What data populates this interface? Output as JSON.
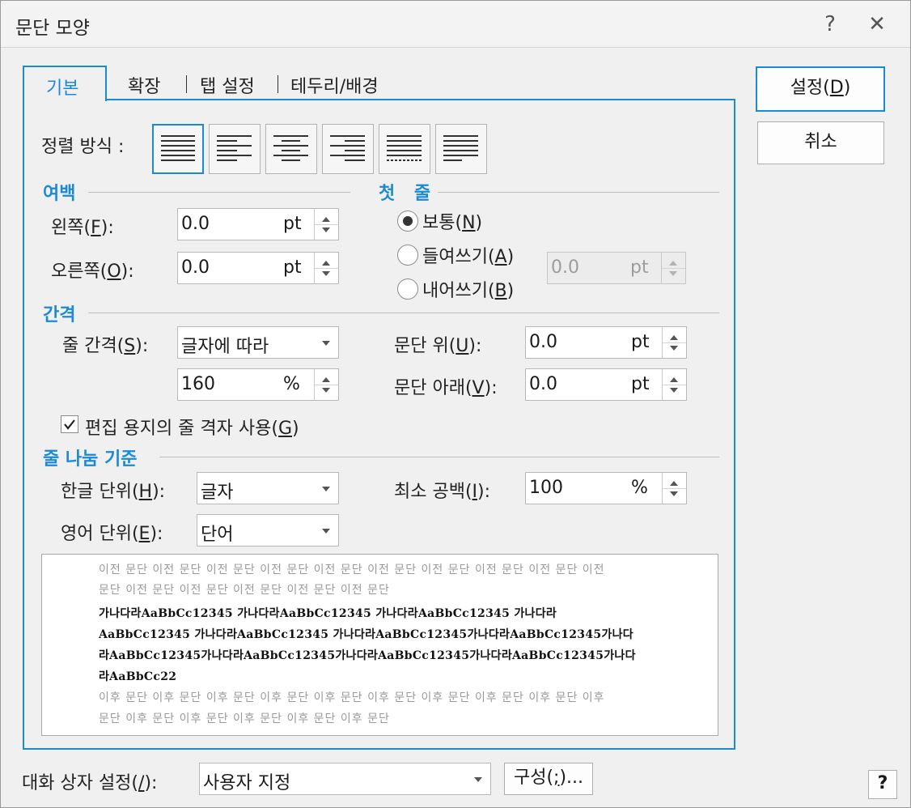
{
  "window": {
    "title": "문단 모양",
    "help_icon": "?",
    "close_icon": "✕"
  },
  "tabs": [
    {
      "label": "기본"
    },
    {
      "label": "확장"
    },
    {
      "label": "탭 설정"
    },
    {
      "label": "테두리/배경"
    }
  ],
  "alignment": {
    "label": "정렬 방식 :",
    "options": [
      "justify",
      "left",
      "center",
      "right",
      "distribute",
      "divide"
    ],
    "selected": "justify"
  },
  "margin": {
    "section": "여백",
    "left_label_pre": "왼쪽(",
    "left_key": "F",
    "left_label_post": "):",
    "left_value": "0.0",
    "left_unit": "pt",
    "right_label_pre": "오른쪽(",
    "right_key": "O",
    "right_label_post": "):",
    "right_value": "0.0",
    "right_unit": "pt"
  },
  "first_line": {
    "section": "첫 줄",
    "normal_pre": "보통(",
    "normal_key": "N",
    "normal_post": ")",
    "indent_pre": "들여쓰기(",
    "indent_key": "A",
    "indent_post": ")",
    "outdent_pre": "내어쓰기(",
    "outdent_key": "B",
    "outdent_post": ")",
    "selected": "normal",
    "value": "0.0",
    "unit": "pt"
  },
  "spacing": {
    "section": "간격",
    "line_label_pre": "줄 간격(",
    "line_key": "S",
    "line_label_post": "):",
    "line_type": "글자에 따라",
    "line_value": "160",
    "line_unit": "%",
    "above_label_pre": "문단 위(",
    "above_key": "U",
    "above_label_post": "):",
    "above_value": "0.0",
    "above_unit": "pt",
    "below_label_pre": "문단 아래(",
    "below_key": "V",
    "below_label_post": "):",
    "below_value": "0.0",
    "below_unit": "pt",
    "grid_pre": "편집 용지의 줄 격자 사용(",
    "grid_key": "G",
    "grid_post": ")",
    "grid_checked": true
  },
  "line_break": {
    "section": "줄 나눔 기준",
    "korean_pre": "한글 단위(",
    "korean_key": "H",
    "korean_post": "):",
    "korean_value": "글자",
    "english_pre": "영어 단위(",
    "english_key": "E",
    "english_post": "):",
    "english_value": "단어",
    "min_space_pre": "최소 공백(",
    "min_space_key": "I",
    "min_space_post": "):",
    "min_space_value": "100",
    "min_space_unit": "%"
  },
  "preview": {
    "before_lines": [
      "이전 문단 이전 문단 이전 문단 이전 문단 이전 문단 이전 문단 이전 문단 이전 문단 이전 문단 이전",
      "문단 이전 문단 이전 문단 이전 문단 이전 문단 이전 문단"
    ],
    "main_lines": [
      "가나다라AaBbCc12345        가나다라AaBbCc12345        가나다라AaBbCc12345        가나다라",
      "AaBbCc12345  가나다라AaBbCc12345  가나다라AaBbCc12345가나다라AaBbCc12345가나다",
      "라AaBbCc12345가나다라AaBbCc12345가나다라AaBbCc12345가나다라AaBbCc12345가나다",
      "라AaBbCc22"
    ],
    "after_lines": [
      "이후 문단 이후 문단 이후 문단 이후 문단 이후 문단 이후 문단 이후 문단 이후 문단 이후 문단 이후",
      "문단 이후 문단 이후 문단 이후 문단 이후 문단 이후 문단"
    ]
  },
  "footer": {
    "preset_pre": "대화 상자 설정(",
    "preset_key": "/",
    "preset_post": "):",
    "preset_value": "사용자 지정",
    "config_pre": "구성(",
    "config_key": ";",
    "config_post": ")...",
    "help_icon": "?"
  },
  "buttons": {
    "ok_pre": "설정(",
    "ok_key": "D",
    "ok_post": ")",
    "cancel": "취소"
  },
  "colors": {
    "accent": "#1c8ad3",
    "background": "#f0f0f0"
  }
}
